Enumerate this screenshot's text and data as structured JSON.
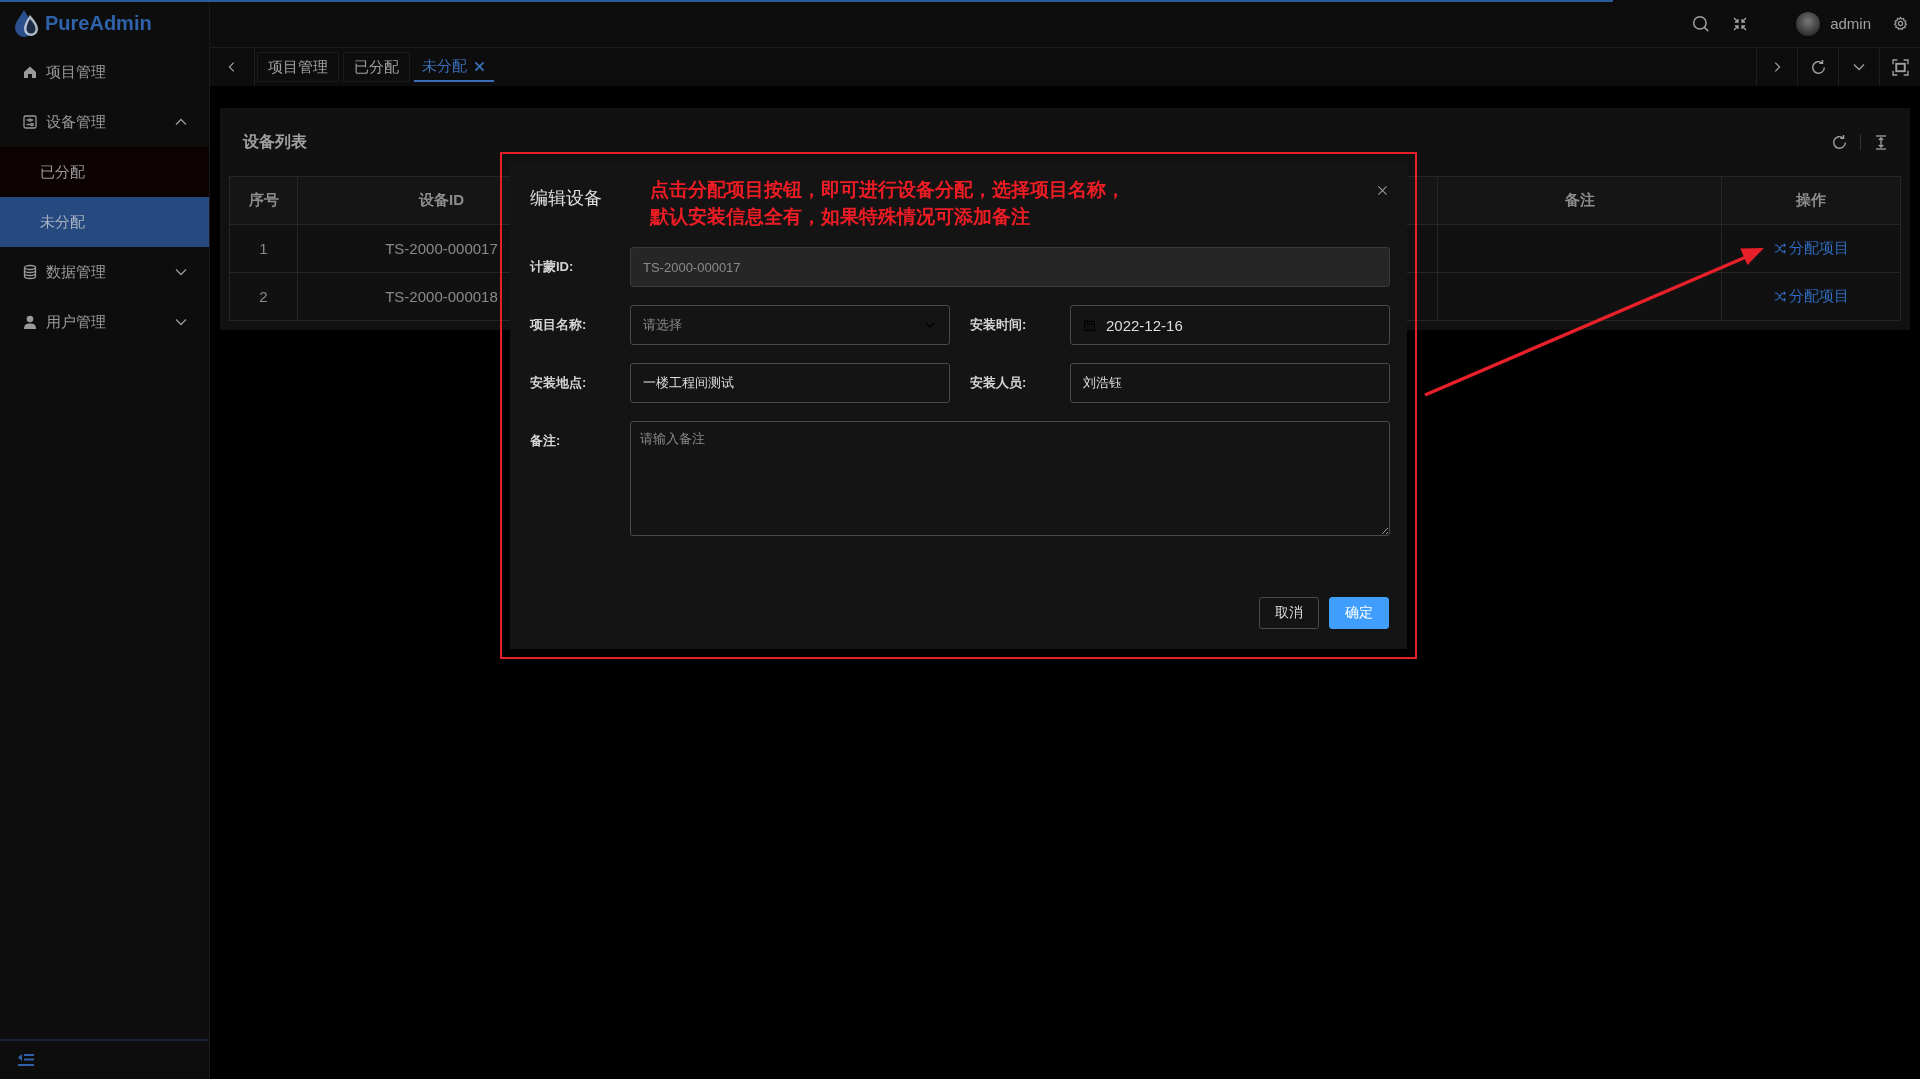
{
  "progress": {
    "level": 0.84
  },
  "logo": {
    "text": "PureAdmin"
  },
  "sidebar": {
    "items": [
      {
        "label": "项目管理"
      },
      {
        "label": "设备管理",
        "expanded": true,
        "children": [
          {
            "label": "已分配",
            "selected": false
          },
          {
            "label": "未分配",
            "selected": true
          }
        ]
      },
      {
        "label": "数据管理",
        "expanded": false
      },
      {
        "label": "用户管理",
        "expanded": false
      }
    ]
  },
  "header": {
    "user": "admin"
  },
  "tabs": [
    {
      "label": "项目管理",
      "selected": false
    },
    {
      "label": "已分配",
      "selected": false
    },
    {
      "label": "未分配",
      "selected": true
    }
  ],
  "card": {
    "title": "设备列表",
    "table": {
      "columns": [
        "序号",
        "设备ID",
        "备注",
        "操作"
      ],
      "rows": [
        {
          "index": "1",
          "device_id": "TS-2000-000017",
          "action": "分配项目"
        },
        {
          "index": "2",
          "device_id": "TS-2000-000018",
          "action": "分配项目"
        }
      ]
    }
  },
  "dialog": {
    "title": "编辑设备",
    "rows": [
      [
        {
          "kind": "text",
          "label": "计蒙ID:",
          "value": "TS-2000-000017",
          "disabled": true
        }
      ],
      [
        {
          "kind": "select",
          "label": "项目名称:",
          "placeholder": "请选择",
          "disabled": false
        },
        {
          "kind": "date",
          "label": "安装时间:",
          "value": "2022-12-16",
          "disabled": false
        }
      ],
      [
        {
          "kind": "text",
          "label": "安装地点:",
          "value": "一楼工程间测试",
          "disabled": false
        },
        {
          "kind": "text",
          "label": "安装人员:",
          "value": "刘浩钰",
          "disabled": false
        }
      ],
      [
        {
          "kind": "textarea",
          "label": "备注:",
          "placeholder": "请输入备注",
          "disabled": false
        }
      ]
    ],
    "buttons": [
      {
        "label": "取消",
        "primary": false
      },
      {
        "label": "确定",
        "primary": true
      }
    ]
  },
  "annotation": {
    "lines": [
      "点击分配项目按钮，即可进行设备分配，选择项目名称，",
      "默认安装信息全有，如果特殊情况可添加备注"
    ]
  }
}
